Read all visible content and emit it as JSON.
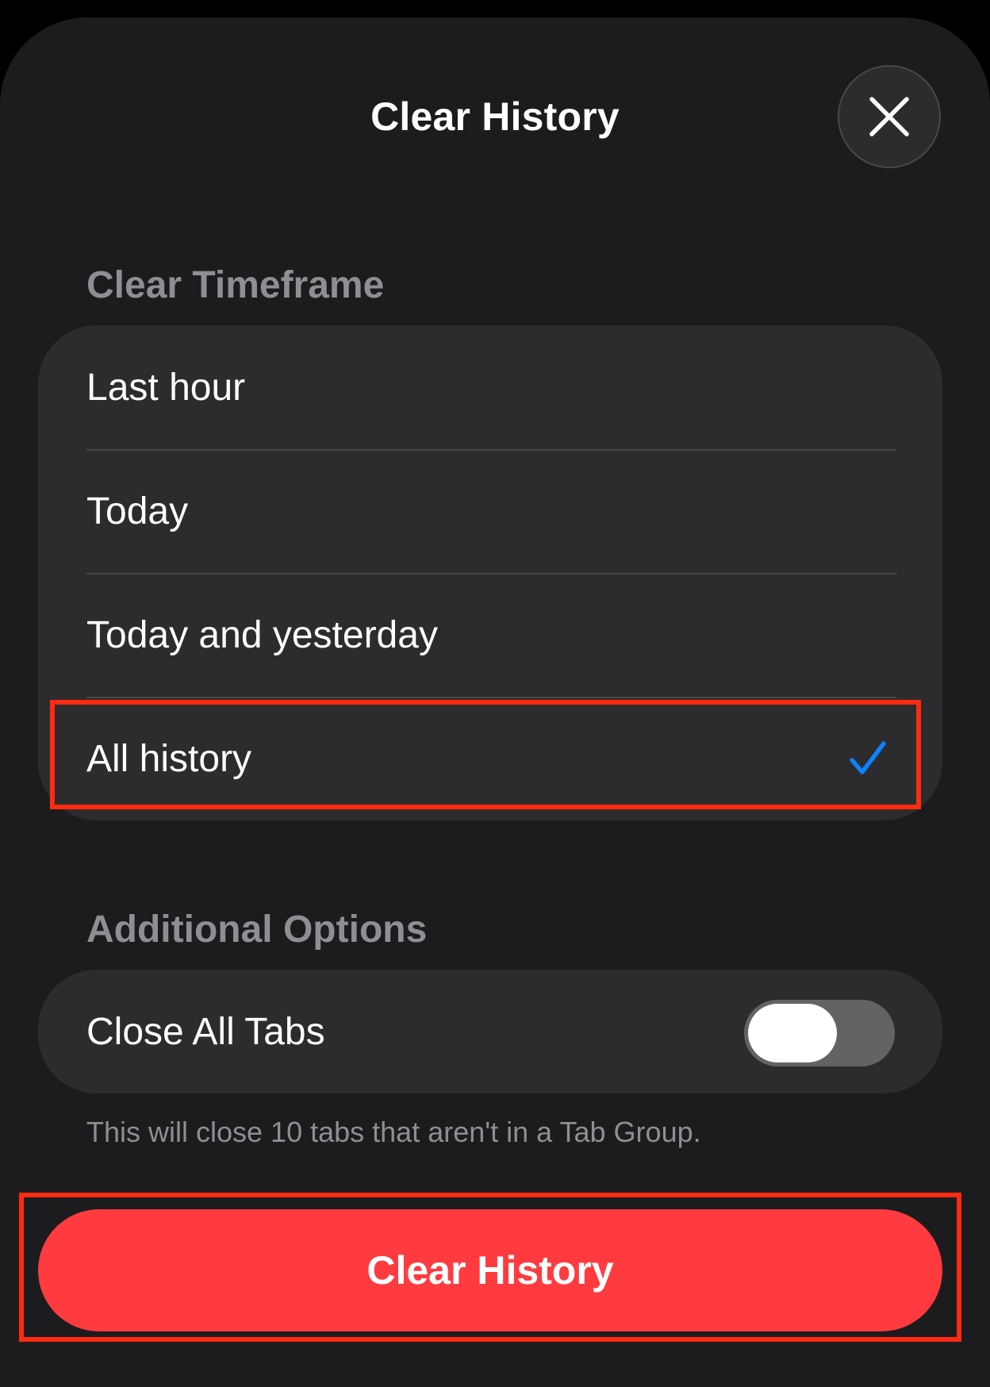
{
  "header": {
    "title": "Clear History",
    "close_icon": "close-icon"
  },
  "timeframe": {
    "section_label": "Clear Timeframe",
    "options": [
      {
        "label": "Last hour",
        "selected": false
      },
      {
        "label": "Today",
        "selected": false
      },
      {
        "label": "Today and yesterday",
        "selected": false
      },
      {
        "label": "All history",
        "selected": true
      }
    ],
    "check_icon": "checkmark-icon",
    "check_color": "#0a84ff"
  },
  "additional": {
    "section_label": "Additional Options",
    "close_all_tabs": {
      "label": "Close All Tabs",
      "enabled": false
    },
    "footnote": "This will close 10 tabs that aren't in a Tab Group."
  },
  "action": {
    "label": "Clear History",
    "color": "#ff3b40"
  },
  "annotations": {
    "highlight_color": "#ff2a12"
  }
}
